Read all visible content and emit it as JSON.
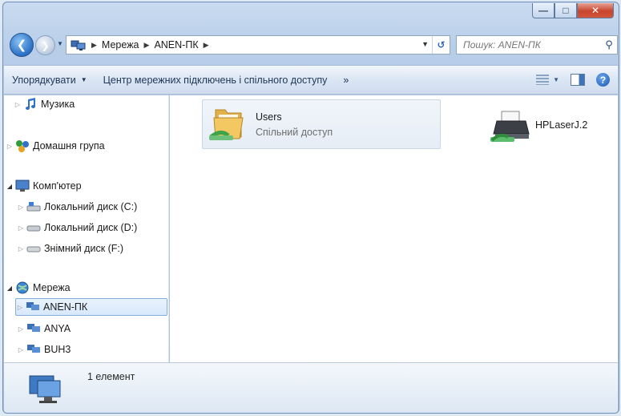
{
  "window": {
    "minimize_glyph": "—",
    "maximize_glyph": "□",
    "close_glyph": "✕"
  },
  "address": {
    "crumbs": [
      "Мережа",
      "ANEN-ПК"
    ],
    "search_placeholder": "Пошук: ANEN-ПК"
  },
  "toolbar": {
    "organize_label": "Упорядкувати",
    "network_center_label": "Центр мережних підключень і спільного доступу",
    "more_label": "»"
  },
  "nav": {
    "music": "Музика",
    "homegroup": "Домашня група",
    "computer": "Комп'ютер",
    "disk_c": "Локальний диск (C:)",
    "disk_d": "Локальний диск (D:)",
    "disk_f": "Знімний диск (F:)",
    "network": "Мережа",
    "anen": "ANEN-ПК",
    "anya": "ANYA",
    "buh3": "BUH3"
  },
  "content": {
    "users_title": "Users",
    "users_subtitle": "Спільний доступ",
    "printer_label": "HPLaserJ.2"
  },
  "status": {
    "count_text": "1 елемент"
  },
  "colors": {
    "accent": "#2a6fc4",
    "close_button": "#c7452c",
    "selection": "#d7e8fb"
  }
}
